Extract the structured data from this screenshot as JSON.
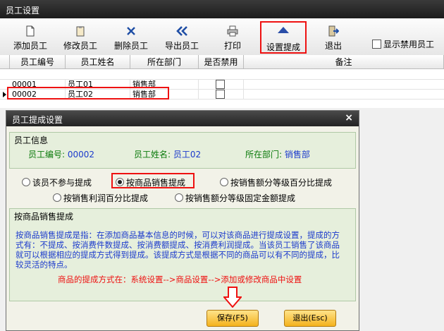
{
  "window": {
    "title": "员工设置"
  },
  "toolbar": {
    "add": "添加员工",
    "edit": "修改员工",
    "delete": "删除员工",
    "export": "导出员工",
    "print": "打印",
    "set_commission": "设置提成",
    "exit": "退出",
    "show_disabled": "显示禁用员工"
  },
  "grid": {
    "headers": [
      "员工编号",
      "员工姓名",
      "所在部门",
      "是否禁用",
      "备注"
    ],
    "rows": [
      {
        "id": "00001",
        "name": "员工01",
        "dept": "销售部"
      },
      {
        "id": "00002",
        "name": "员工02",
        "dept": "销售部"
      }
    ]
  },
  "dialog": {
    "title": "员工提成设置",
    "info_group": "员工信息",
    "emp_id_label": "员工编号:",
    "emp_id": "00002",
    "emp_name_label": "员工姓名:",
    "emp_name": "员工02",
    "dept_label": "所在部门:",
    "dept": "销售部",
    "options": [
      "该员不参与提成",
      "按商品销售提成",
      "按销售额分等级百分比提成",
      "按销售利润百分比提成",
      "按销售额分等级固定金额提成"
    ],
    "detail_group": "按商品销售提成",
    "desc": "按商品销售提成是指：在添加商品基本信息的时候，可以对该商品进行提成设置，提成的方式有：不提成、按消费件数提成、按消费额提成、按消费利润提成。当该员工销售了该商品就可以根据相应的提成方式得到提成。该提成方式是根据不同的商品可以有不同的提成，比较灵活的特点。",
    "path_note": "商品的提成方式在：系统设置-->商品设置-->添加或修改商品中设置",
    "save": "保存(F5)",
    "exit": "退出(Esc)",
    "close": "×"
  }
}
